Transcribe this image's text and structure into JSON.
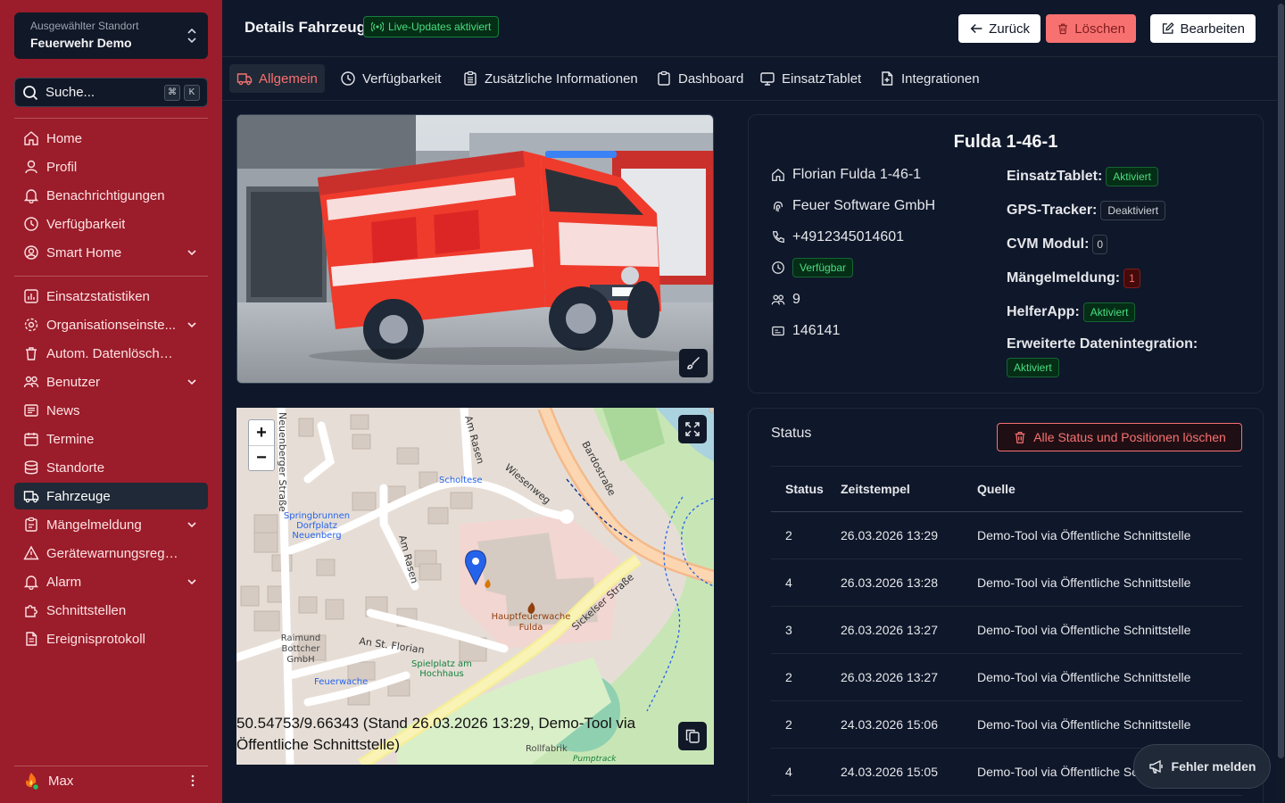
{
  "sidebar": {
    "location": {
      "label": "Ausgewählter Standort",
      "value": "Feuerwehr Demo"
    },
    "search": {
      "placeholder": "Suche...",
      "kbd1": "⌘",
      "kbd2": "K"
    },
    "group1": [
      {
        "label": "Home",
        "icon": "home-icon"
      },
      {
        "label": "Profil",
        "icon": "user-icon"
      },
      {
        "label": "Benachrichtigungen",
        "icon": "bell-icon"
      },
      {
        "label": "Verfügbarkeit",
        "icon": "clock-icon"
      },
      {
        "label": "Smart Home",
        "icon": "user-circle-icon"
      }
    ],
    "group2": [
      {
        "label": "Einsatzstatistiken",
        "icon": "chart-icon"
      },
      {
        "label": "Organisationseinste...",
        "icon": "gear-icon"
      },
      {
        "label": "Autom. Datenlöschung",
        "icon": "trash-icon"
      },
      {
        "label": "Benutzer",
        "icon": "users-icon"
      },
      {
        "label": "News",
        "icon": "newspaper-icon"
      },
      {
        "label": "Termine",
        "icon": "calendar-icon"
      },
      {
        "label": "Standorte",
        "icon": "database-icon"
      },
      {
        "label": "Fahrzeuge",
        "icon": "truck-icon"
      },
      {
        "label": "Mängelmeldung",
        "icon": "clipboard-icon"
      },
      {
        "label": "Gerätewarnungsregeln",
        "icon": "warning-icon"
      },
      {
        "label": "Alarm",
        "icon": "bell-icon"
      },
      {
        "label": "Schnittstellen",
        "icon": "puzzle-icon"
      },
      {
        "label": "Ereignisprotokoll",
        "icon": "document-icon"
      }
    ],
    "user": {
      "name": "Max"
    }
  },
  "header": {
    "title": "Details Fahrzeug",
    "live_badge": "Live-Updates aktiviert",
    "back_label": "Zurück",
    "delete_label": "Löschen",
    "edit_label": "Bearbeiten"
  },
  "tabs": [
    {
      "label": "Allgemein",
      "active": true
    },
    {
      "label": "Verfügbarkeit"
    },
    {
      "label": "Zusätzliche Informationen"
    },
    {
      "label": "Dashboard"
    },
    {
      "label": "EinsatzTablet"
    },
    {
      "label": "Integrationen"
    }
  ],
  "map": {
    "caption": "50.54753/9.66343 (Stand 26.03.2026 13:29, Demo-Tool via Öffentliche Schnittstelle)",
    "labels": {
      "street1": "Neuenberger Straße",
      "street2": "Am Rasen",
      "street3": "Wiesenweg",
      "street4": "Bardostraße",
      "street5": "An St. Florian",
      "street6": "Sickelser Straße",
      "poi1": "Scholtese",
      "poi2": "Springbrunnen Dorfplatz Neuenberg",
      "poi3": "Hauptfeuerwache Fulda",
      "poi4": "Raimund Bottcher GmbH",
      "poi5": "Feuerwache",
      "poi6": "Spielplatz am Hochhaus",
      "poi7": "Rollfabrik",
      "poi8": "Pumptrack"
    }
  },
  "vehicle": {
    "name": "Fulda 1-46-1",
    "radio_name": "Florian Fulda 1-46-1",
    "provider": "Feuer Software GmbH",
    "phone": "+4912345014601",
    "availability": "Verfügbar",
    "crew": "9",
    "id": "146141"
  },
  "properties": {
    "tablet_label": "EinsatzTablet:",
    "tablet_value": "Aktiviert",
    "gps_label": "GPS-Tracker:",
    "gps_value": "Deaktiviert",
    "cvm_label": "CVM Modul:",
    "cvm_value": "0",
    "defect_label": "Mängelmeldung:",
    "defect_value": "1",
    "helper_label": "HelferApp:",
    "helper_value": "Aktiviert",
    "ext_label": "Erweiterte Datenintegration:",
    "ext_value": "Aktiviert"
  },
  "status": {
    "title": "Status",
    "clear_label": "Alle Status und Positionen löschen",
    "columns": [
      "Status",
      "Zeitstempel",
      "Quelle"
    ],
    "rows": [
      [
        "2",
        "26.03.2026 13:29",
        "Demo-Tool via Öffentliche Schnittstelle"
      ],
      [
        "4",
        "26.03.2026 13:28",
        "Demo-Tool via Öffentliche Schnittstelle"
      ],
      [
        "3",
        "26.03.2026 13:27",
        "Demo-Tool via Öffentliche Schnittstelle"
      ],
      [
        "2",
        "26.03.2026 13:27",
        "Demo-Tool via Öffentliche Schnittstelle"
      ],
      [
        "2",
        "24.03.2026 15:06",
        "Demo-Tool via Öffentliche Schnittstelle"
      ],
      [
        "4",
        "24.03.2026 15:05",
        "Demo-Tool via Öffentliche Schnittstelle"
      ]
    ]
  },
  "fab": {
    "label": "Fehler melden"
  },
  "colors": {
    "sidebar": "#9b1c2a",
    "background": "#0f172a",
    "accent": "#f87171",
    "success": "#4ade80"
  }
}
